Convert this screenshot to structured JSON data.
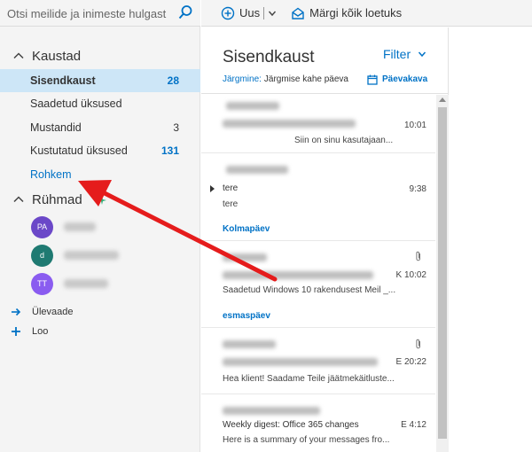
{
  "search": {
    "placeholder": "Otsi meilide ja inimeste hulgast"
  },
  "toolbar": {
    "new_label": "Uus",
    "mark_all_read_label": "Märgi kõik loetuks"
  },
  "sidebar": {
    "folders_heading": "Kaustad",
    "folders": [
      {
        "name": "Sisendkaust",
        "count": "28",
        "active": true
      },
      {
        "name": "Saadetud üksused",
        "count": ""
      },
      {
        "name": "Mustandid",
        "count": "3"
      },
      {
        "name": "Kustutatud üksused",
        "count": "131"
      }
    ],
    "more_label": "Rohkem",
    "groups_heading": "Rühmad",
    "groups": [
      {
        "initials": "PA",
        "color": "#6b48c8"
      },
      {
        "initials": "d",
        "color": "#1f7a72"
      },
      {
        "initials": "TT",
        "color": "#8a5cf0"
      }
    ],
    "overview_label": "Ülevaade",
    "create_label": "Loo"
  },
  "list": {
    "title": "Sisendkaust",
    "filter_label": "Filter",
    "agenda_label": "Järgmine:",
    "agenda_text": "Järgmise kahe päeva",
    "calendar_label": "Päevakava",
    "messages": [
      {
        "time": "10:01",
        "preview": "Siin on sinu kasutajaan..."
      },
      {
        "subject": "tere",
        "time": "9:38",
        "preview": "tere"
      },
      {
        "time": "K 10:02",
        "preview": "Saadetud Windows 10 rakendusest Meil _..."
      },
      {
        "time": "E 20:22",
        "preview": "Hea klient! Saadame Teile jäätmekäitluste..."
      },
      {
        "subject": "Weekly digest: Office 365 changes",
        "time": "E 4:12",
        "preview": "Here is a summary of your messages fro..."
      }
    ],
    "day_headers": [
      "Kolmapäev",
      "esmaspäev"
    ]
  },
  "colors": {
    "accent": "#0072c6",
    "arrow": "#e51c1c",
    "selected_bg": "#cde6f7"
  }
}
